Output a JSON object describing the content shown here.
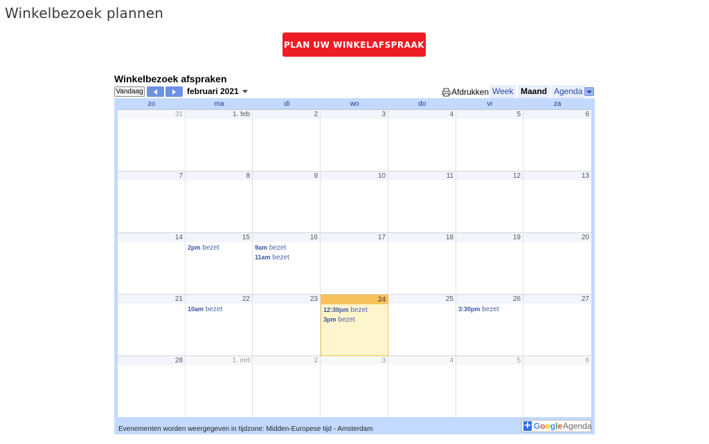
{
  "page": {
    "title": "Winkelbezoek plannen",
    "cta_label": "PLAN UW WINKELAFSPRAAK"
  },
  "calendar": {
    "title": "Winkelbezoek afspraken",
    "today_label": "Vandaag",
    "month_label": "februari 2021",
    "print_label": "Afdrukken",
    "tabs": {
      "week": "Week",
      "month": "Maand",
      "agenda": "Agenda"
    },
    "active_tab": "Maand",
    "weekdays": [
      "zo",
      "ma",
      "di",
      "wo",
      "do",
      "vr",
      "za"
    ],
    "weeks": [
      [
        {
          "label": "31",
          "other": true
        },
        {
          "label": "1. feb"
        },
        {
          "label": "2"
        },
        {
          "label": "3"
        },
        {
          "label": "4"
        },
        {
          "label": "5"
        },
        {
          "label": "6"
        }
      ],
      [
        {
          "label": "7"
        },
        {
          "label": "8"
        },
        {
          "label": "9"
        },
        {
          "label": "10"
        },
        {
          "label": "11"
        },
        {
          "label": "12"
        },
        {
          "label": "13"
        }
      ],
      [
        {
          "label": "14"
        },
        {
          "label": "15",
          "events": [
            {
              "time": "2pm",
              "text": "bezet"
            }
          ]
        },
        {
          "label": "16",
          "events": [
            {
              "time": "9am",
              "text": "bezet"
            },
            {
              "time": "11am",
              "text": "bezet"
            }
          ]
        },
        {
          "label": "17"
        },
        {
          "label": "18"
        },
        {
          "label": "19"
        },
        {
          "label": "20"
        }
      ],
      [
        {
          "label": "21"
        },
        {
          "label": "22",
          "events": [
            {
              "time": "10am",
              "text": "bezet"
            }
          ]
        },
        {
          "label": "23"
        },
        {
          "label": "24",
          "today": true,
          "events": [
            {
              "time": "12:30pm",
              "text": "bezet"
            },
            {
              "time": "3pm",
              "text": "bezet"
            }
          ]
        },
        {
          "label": "25"
        },
        {
          "label": "26",
          "events": [
            {
              "time": "3:30pm",
              "text": "bezet"
            }
          ]
        },
        {
          "label": "27"
        }
      ],
      [
        {
          "label": "28"
        },
        {
          "label": "1. mrt",
          "other": true
        },
        {
          "label": "2",
          "other": true
        },
        {
          "label": "3",
          "other": true
        },
        {
          "label": "4",
          "other": true
        },
        {
          "label": "5",
          "other": true
        },
        {
          "label": "6",
          "other": true
        }
      ]
    ],
    "timezone_note": "Evenementen worden weergegeven in tijdzone: Midden-Europese tijd - Amsterdam",
    "badge": {
      "plus": "+",
      "google": "Google",
      "agenda": "Agenda",
      "google_letter_colors": [
        "#4285f4",
        "#ea4335",
        "#fbbc05",
        "#4285f4",
        "#34a853",
        "#ea4335"
      ]
    }
  },
  "colors": {
    "cta": "#ee1c25",
    "frame": "#c3d9ff",
    "today_bg": "#fff5cc",
    "today_header": "#f7c25b",
    "nav_button": "#6d8fe6"
  },
  "icons": {
    "prev": "chevron-left-icon",
    "next": "chevron-right-icon",
    "print": "printer-icon",
    "dropdown": "caret-down-icon",
    "add": "plus-icon"
  }
}
